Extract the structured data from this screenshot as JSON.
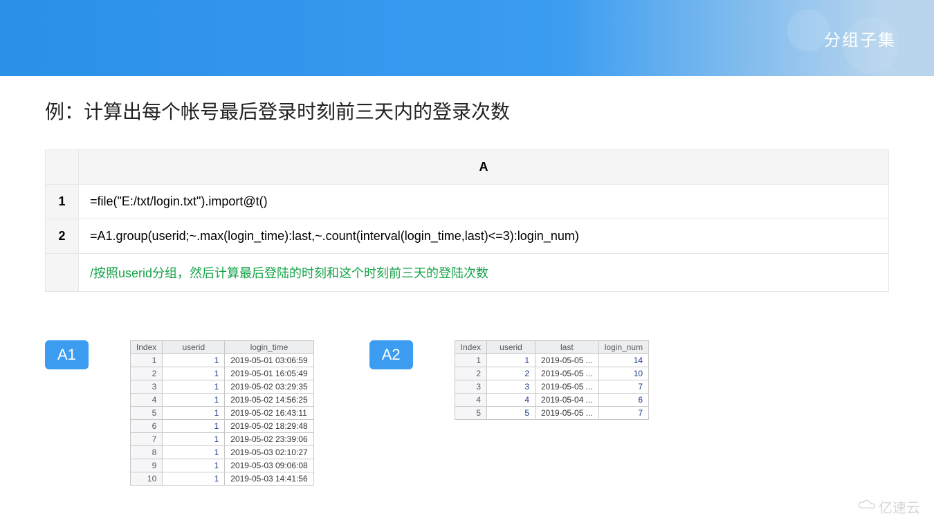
{
  "banner": {
    "title": "分组子集"
  },
  "heading": "例：计算出每个帐号最后登录时刻前三天内的登录次数",
  "code_table": {
    "header_col": "A",
    "rows": [
      {
        "n": "1",
        "code": "=file(\"E:/txt/login.txt\").import@t()"
      },
      {
        "n": "2",
        "code": "=A1.group(userid;~.max(login_time):last,~.count(interval(login_time,last)<=3):login_num)"
      }
    ],
    "comment": "/按照userid分组，然后计算最后登陆的时刻和这个时刻前三天的登陆次数"
  },
  "result_a1": {
    "badge": "A1",
    "headers": [
      "Index",
      "userid",
      "login_time"
    ],
    "rows": [
      [
        "1",
        "1",
        "2019-05-01 03:06:59"
      ],
      [
        "2",
        "1",
        "2019-05-01 16:05:49"
      ],
      [
        "3",
        "1",
        "2019-05-02 03:29:35"
      ],
      [
        "4",
        "1",
        "2019-05-02 14:56:25"
      ],
      [
        "5",
        "1",
        "2019-05-02 16:43:11"
      ],
      [
        "6",
        "1",
        "2019-05-02 18:29:48"
      ],
      [
        "7",
        "1",
        "2019-05-02 23:39:06"
      ],
      [
        "8",
        "1",
        "2019-05-03 02:10:27"
      ],
      [
        "9",
        "1",
        "2019-05-03 09:06:08"
      ],
      [
        "10",
        "1",
        "2019-05-03 14:41:56"
      ]
    ]
  },
  "result_a2": {
    "badge": "A2",
    "headers": [
      "Index",
      "userid",
      "last",
      "login_num"
    ],
    "rows": [
      [
        "1",
        "1",
        "2019-05-05 ...",
        "14"
      ],
      [
        "2",
        "2",
        "2019-05-05 ...",
        "10"
      ],
      [
        "3",
        "3",
        "2019-05-05 ...",
        "7"
      ],
      [
        "4",
        "4",
        "2019-05-04 ...",
        "6"
      ],
      [
        "5",
        "5",
        "2019-05-05 ...",
        "7"
      ]
    ]
  },
  "watermark": "亿速云"
}
